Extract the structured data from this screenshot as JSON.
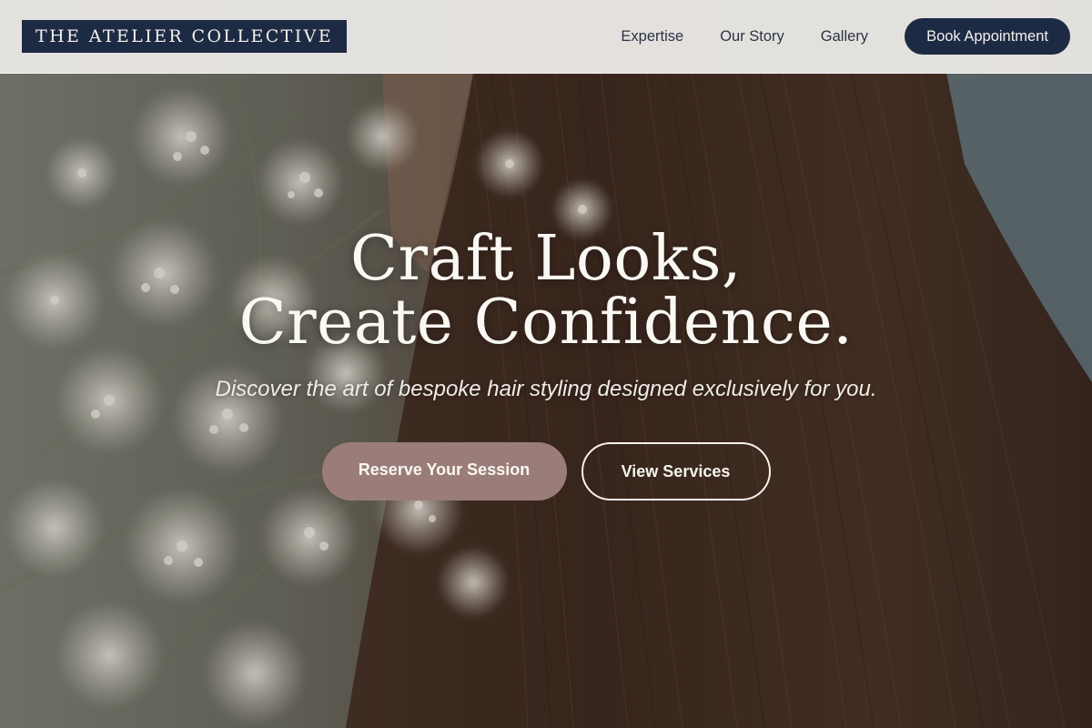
{
  "header": {
    "logo": "THE ATELIER COLLECTIVE",
    "nav": [
      {
        "label": "Expertise"
      },
      {
        "label": "Our Story"
      },
      {
        "label": "Gallery"
      }
    ],
    "book_button": "Book Appointment"
  },
  "hero": {
    "title_line_1": "Craft Looks,",
    "title_line_2": "Create Confidence.",
    "subtitle": "Discover the art of bespoke hair styling designed exclusively for you.",
    "primary_cta": "Reserve Your Session",
    "secondary_cta": "View Services",
    "background_image": "hair-and-babys-breath-flowers-photo"
  },
  "colors": {
    "brand_navy": "#1d2a44",
    "cta_mauve": "#9a7d78",
    "header_bg": "#f0efec",
    "hero_text": "#faf8f3"
  }
}
